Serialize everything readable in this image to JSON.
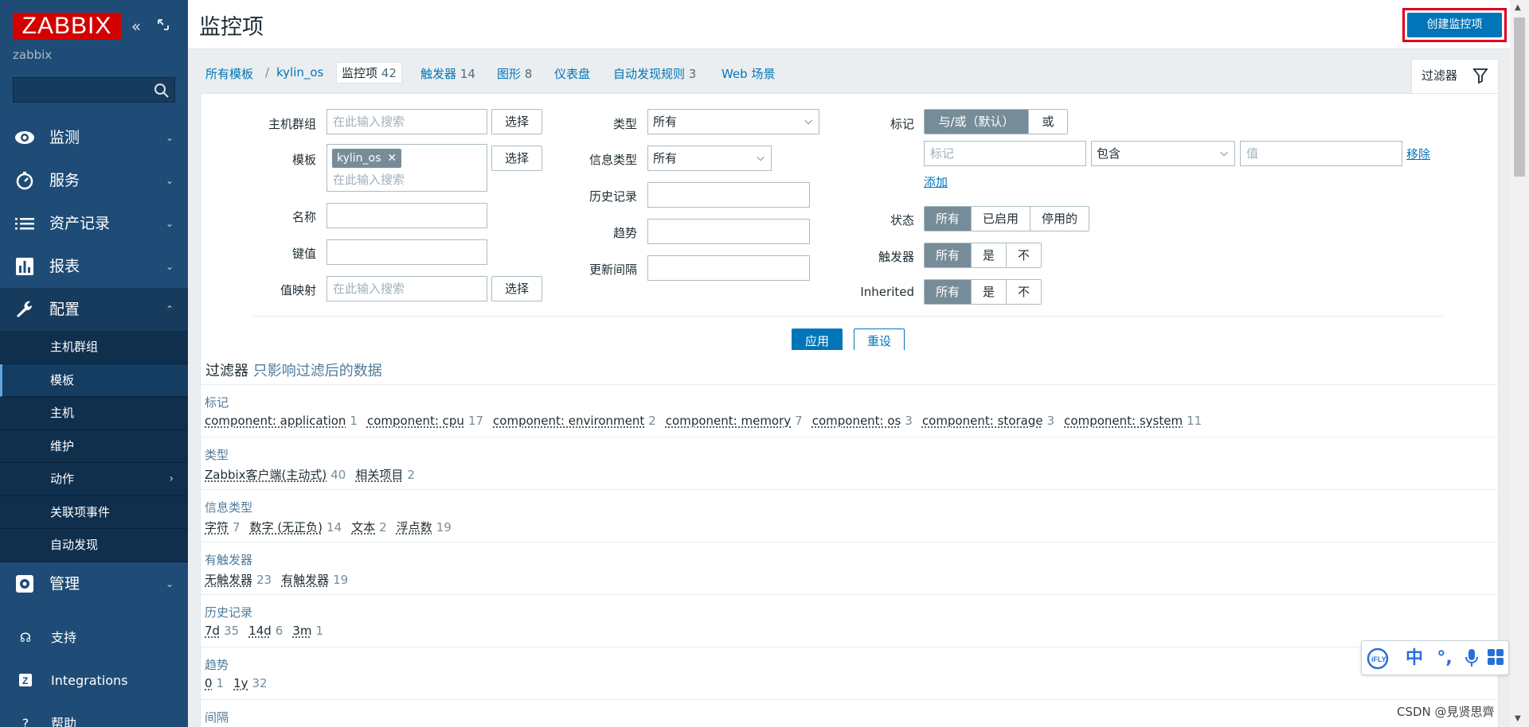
{
  "sidebar": {
    "logo": "ZABBIX",
    "server_name": "zabbix",
    "search_placeholder": "",
    "nav": [
      {
        "label": "监测",
        "icon": "eye-icon"
      },
      {
        "label": "服务",
        "icon": "clock-icon"
      },
      {
        "label": "资产记录",
        "icon": "list-icon"
      },
      {
        "label": "报表",
        "icon": "bar-chart-icon"
      },
      {
        "label": "配置",
        "icon": "wrench-icon"
      }
    ],
    "config_sub": [
      "主机群组",
      "模板",
      "主机",
      "维护",
      "动作",
      "关联项事件",
      "自动发现"
    ],
    "admin": {
      "label": "管理",
      "icon": "gear-icon"
    },
    "support": "支持",
    "integrations": "Integrations",
    "help": "帮助"
  },
  "header": {
    "title": "监控项",
    "create_button": "创建监控项"
  },
  "breadcrumbs": {
    "all_templates": "所有模板",
    "separator": "/",
    "template": "kylin_os",
    "items": {
      "label": "监控项",
      "count": "42"
    },
    "triggers": {
      "label": "触发器",
      "count": "14"
    },
    "graphs": {
      "label": "图形",
      "count": "8"
    },
    "dashboards": {
      "label": "仪表盘"
    },
    "discovery": {
      "label": "自动发现规则",
      "count": "3"
    },
    "web": {
      "label": "Web 场景"
    }
  },
  "filter_tab": "过滤器",
  "filter": {
    "host_group": {
      "label": "主机群组",
      "placeholder": "在此输入搜索",
      "button": "选择"
    },
    "template": {
      "label": "模板",
      "chip": "kylin_os",
      "placeholder": "在此输入搜索",
      "button": "选择"
    },
    "name": {
      "label": "名称",
      "value": ""
    },
    "key": {
      "label": "键值",
      "value": ""
    },
    "value_map": {
      "label": "值映射",
      "placeholder": "在此输入搜索",
      "button": "选择"
    },
    "type": {
      "label": "类型",
      "value": "所有"
    },
    "info_type": {
      "label": "信息类型",
      "value": "所有"
    },
    "history": {
      "label": "历史记录",
      "value": ""
    },
    "trends": {
      "label": "趋势",
      "value": ""
    },
    "update_interval": {
      "label": "更新间隔",
      "value": ""
    },
    "tags": {
      "label": "标记",
      "options": [
        "与/或（默认）",
        "或"
      ],
      "tag_placeholder": "标记",
      "operator": "包含",
      "value_placeholder": "值",
      "remove": "移除",
      "add": "添加"
    },
    "state": {
      "label": "状态",
      "options": [
        "所有",
        "已启用",
        "停用的"
      ]
    },
    "triggers": {
      "label": "触发器",
      "options": [
        "所有",
        "是",
        "不"
      ]
    },
    "inherited": {
      "label": "Inherited",
      "options": [
        "所有",
        "是",
        "不"
      ]
    },
    "apply": "应用",
    "reset": "重设"
  },
  "subfilter": {
    "title": "过滤器",
    "subtitle": "只影响过滤后的数据",
    "groups": [
      {
        "title": "标记",
        "items": [
          {
            "name": "component: application",
            "count": "1"
          },
          {
            "name": "component: cpu",
            "count": "17"
          },
          {
            "name": "component: environment",
            "count": "2"
          },
          {
            "name": "component: memory",
            "count": "7"
          },
          {
            "name": "component: os",
            "count": "3"
          },
          {
            "name": "component: storage",
            "count": "3"
          },
          {
            "name": "component: system",
            "count": "11"
          }
        ]
      },
      {
        "title": "类型",
        "items": [
          {
            "name": "Zabbix客户端(主动式)",
            "count": "40"
          },
          {
            "name": "相关项目",
            "count": "2"
          }
        ]
      },
      {
        "title": "信息类型",
        "items": [
          {
            "name": "字符",
            "count": "7"
          },
          {
            "name": "数字 (无正负)",
            "count": "14"
          },
          {
            "name": "文本",
            "count": "2"
          },
          {
            "name": "浮点数",
            "count": "19"
          }
        ]
      },
      {
        "title": "有触发器",
        "items": [
          {
            "name": "无触发器",
            "count": "23"
          },
          {
            "name": "有触发器",
            "count": "19"
          }
        ]
      },
      {
        "title": "历史记录",
        "items": [
          {
            "name": "7d",
            "count": "35"
          },
          {
            "name": "14d",
            "count": "6"
          },
          {
            "name": "3m",
            "count": "1"
          }
        ]
      },
      {
        "title": "趋势",
        "items": [
          {
            "name": "0",
            "count": "1"
          },
          {
            "name": "1y",
            "count": "32"
          }
        ]
      },
      {
        "title": "间隔",
        "items": []
      }
    ]
  },
  "ime_toolbar": {
    "middle_char": "中"
  },
  "watermark": "CSDN @見贤思齊"
}
